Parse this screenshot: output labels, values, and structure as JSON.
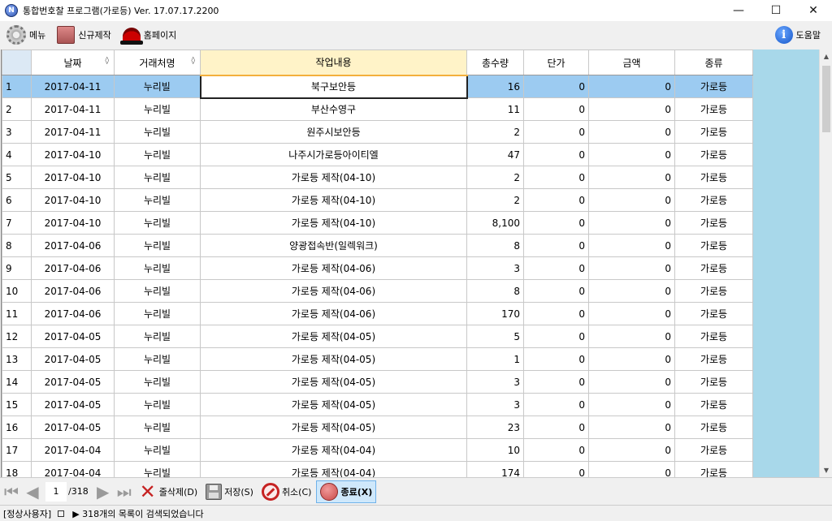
{
  "window": {
    "title": "통합번호찰 프로그램(가로등) Ver. 17.07.17.2200",
    "minimize": "—",
    "maximize": "☐",
    "close": "✕"
  },
  "toolbar": {
    "menu_label": "메뉴",
    "new_label": "신규제작",
    "home_label": "홈페이지",
    "help_label": "도움말"
  },
  "grid": {
    "columns": [
      "",
      "날짜",
      "거래처명",
      "작업내용",
      "총수량",
      "단가",
      "금액",
      "종류"
    ],
    "sort_mark": "◊",
    "rows": [
      {
        "n": "1",
        "date": "2017-04-11",
        "client": "누리빌",
        "work": "북구보안등",
        "qty": "16",
        "price": "0",
        "amount": "0",
        "kind": "가로등"
      },
      {
        "n": "2",
        "date": "2017-04-11",
        "client": "누리빌",
        "work": "부산수영구",
        "qty": "11",
        "price": "0",
        "amount": "0",
        "kind": "가로등"
      },
      {
        "n": "3",
        "date": "2017-04-11",
        "client": "누리빌",
        "work": "원주시보안등",
        "qty": "2",
        "price": "0",
        "amount": "0",
        "kind": "가로등"
      },
      {
        "n": "4",
        "date": "2017-04-10",
        "client": "누리빌",
        "work": "나주시가로등아이티엘",
        "qty": "47",
        "price": "0",
        "amount": "0",
        "kind": "가로등"
      },
      {
        "n": "5",
        "date": "2017-04-10",
        "client": "누리빌",
        "work": "가로등 제작(04-10)",
        "qty": "2",
        "price": "0",
        "amount": "0",
        "kind": "가로등"
      },
      {
        "n": "6",
        "date": "2017-04-10",
        "client": "누리빌",
        "work": "가로등 제작(04-10)",
        "qty": "2",
        "price": "0",
        "amount": "0",
        "kind": "가로등"
      },
      {
        "n": "7",
        "date": "2017-04-10",
        "client": "누리빌",
        "work": "가로등 제작(04-10)",
        "qty": "8,100",
        "price": "0",
        "amount": "0",
        "kind": "가로등"
      },
      {
        "n": "8",
        "date": "2017-04-06",
        "client": "누리빌",
        "work": "양광접속반(일렉워크)",
        "qty": "8",
        "price": "0",
        "amount": "0",
        "kind": "가로등"
      },
      {
        "n": "9",
        "date": "2017-04-06",
        "client": "누리빌",
        "work": "가로등 제작(04-06)",
        "qty": "3",
        "price": "0",
        "amount": "0",
        "kind": "가로등"
      },
      {
        "n": "10",
        "date": "2017-04-06",
        "client": "누리빌",
        "work": "가로등 제작(04-06)",
        "qty": "8",
        "price": "0",
        "amount": "0",
        "kind": "가로등"
      },
      {
        "n": "11",
        "date": "2017-04-06",
        "client": "누리빌",
        "work": "가로등 제작(04-06)",
        "qty": "170",
        "price": "0",
        "amount": "0",
        "kind": "가로등"
      },
      {
        "n": "12",
        "date": "2017-04-05",
        "client": "누리빌",
        "work": "가로등 제작(04-05)",
        "qty": "5",
        "price": "0",
        "amount": "0",
        "kind": "가로등"
      },
      {
        "n": "13",
        "date": "2017-04-05",
        "client": "누리빌",
        "work": "가로등 제작(04-05)",
        "qty": "1",
        "price": "0",
        "amount": "0",
        "kind": "가로등"
      },
      {
        "n": "14",
        "date": "2017-04-05",
        "client": "누리빌",
        "work": "가로등 제작(04-05)",
        "qty": "3",
        "price": "0",
        "amount": "0",
        "kind": "가로등"
      },
      {
        "n": "15",
        "date": "2017-04-05",
        "client": "누리빌",
        "work": "가로등 제작(04-05)",
        "qty": "3",
        "price": "0",
        "amount": "0",
        "kind": "가로등"
      },
      {
        "n": "16",
        "date": "2017-04-05",
        "client": "누리빌",
        "work": "가로등 제작(04-05)",
        "qty": "23",
        "price": "0",
        "amount": "0",
        "kind": "가로등"
      },
      {
        "n": "17",
        "date": "2017-04-04",
        "client": "누리빌",
        "work": "가로등 제작(04-04)",
        "qty": "10",
        "price": "0",
        "amount": "0",
        "kind": "가로등"
      },
      {
        "n": "18",
        "date": "2017-04-04",
        "client": "누리빌",
        "work": "가로등 제작(04-04)",
        "qty": "174",
        "price": "0",
        "amount": "0",
        "kind": "가로등"
      }
    ]
  },
  "nav": {
    "page": "1",
    "total": "/318",
    "delete_label": "줄삭제(D)",
    "save_label": "저장(S)",
    "cancel_label": "취소(C)",
    "exit_label": "종료(X)"
  },
  "status": {
    "user": "[정상사용자]",
    "message": "▶ 318개의 목록이 검색되었습니다"
  },
  "colors": {
    "selected_row": "#9ccbf1",
    "header_highlight": "#fff3c8",
    "grid_background": "#a8d8ea"
  }
}
